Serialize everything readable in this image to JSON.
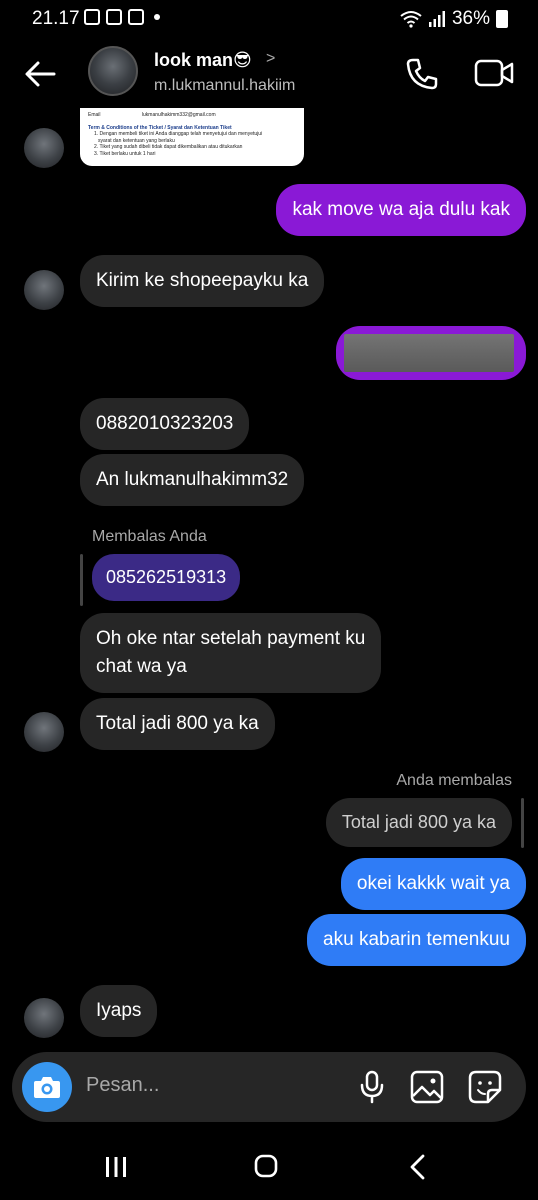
{
  "status_bar": {
    "time": "21.17",
    "battery": "36%"
  },
  "header": {
    "name": "look man😎",
    "chevron": ">",
    "username": "m.lukmannul.hakiim"
  },
  "ticket": {
    "email_label": "Email",
    "email_value": "lukmanulhakimm332@gmail.com",
    "title": "Term & Conditions of the Ticket / Syarat dan Ketentuan Tiket",
    "lines": [
      "1. Dengan membeli tiket ini Anda dianggap telah menyetujui dan menyetujui",
      "syarat dan ketentuan yang berlaku",
      "2. Tiket yang sudah dibeli tidak dapat dikembalikan atau ditukarkan",
      "3. Tiket berlaku untuk 1 hari"
    ]
  },
  "messages": {
    "m1": "kak move wa aja dulu kak",
    "m2": "Kirim ke shopeepayku ka",
    "m3": "0882010323203",
    "m4": "An lukmanulhakimm32",
    "reply1_label": "Membalas Anda",
    "reply1_quote": "085262519313",
    "m5_line1": "Oh oke ntar setelah payment ku",
    "m5_line2": "chat wa ya",
    "m6": "Total jadi 800 ya ka",
    "reply2_label": "Anda membalas",
    "reply2_quote": "Total jadi 800 ya ka",
    "m7": "okei kakkk wait ya",
    "m8": "aku kabarin temenkuu",
    "m9": "Iyaps"
  },
  "composer": {
    "placeholder": "Pesan..."
  },
  "colors": {
    "outgoing_purple": "#8a19d6",
    "outgoing_blue": "#2f7cf6",
    "incoming": "#262626",
    "camera": "#3897f0"
  }
}
